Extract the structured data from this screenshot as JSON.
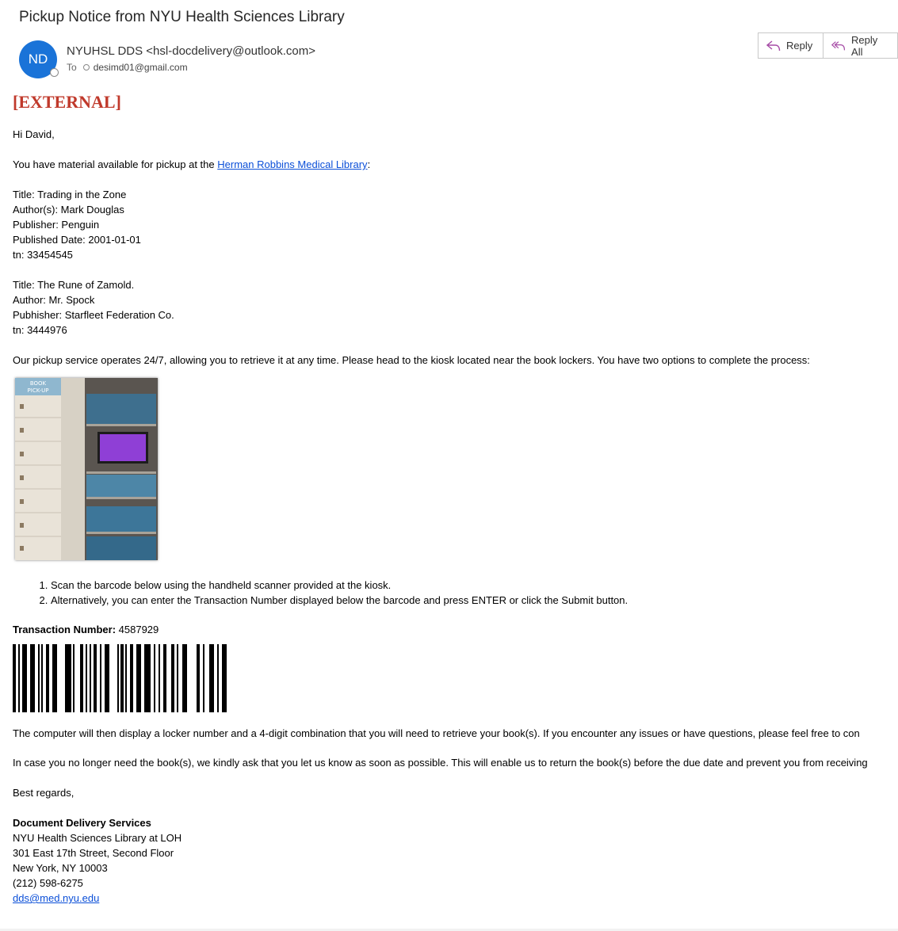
{
  "email": {
    "subject": "Pickup Notice from NYU Health Sciences Library",
    "avatar_initials": "ND",
    "sender": "NYUHSL DDS <hsl-docdelivery@outlook.com>",
    "to_label": "To",
    "recipient": "desimd01@gmail.com",
    "actions": {
      "reply": "Reply",
      "reply_all": "Reply All"
    }
  },
  "body": {
    "external_tag": "[EXTERNAL]",
    "greeting": "Hi David,",
    "intro_before": "You have material available for pickup at the ",
    "library_link": "Herman Robbins Medical Library",
    "intro_after": ":",
    "items": [
      {
        "lines": [
          "Title: Trading in the Zone",
          "Author(s): Mark Douglas",
          "Publisher: Penguin",
          "Published Date: 2001-01-01",
          "tn: 33454545"
        ]
      },
      {
        "lines": [
          "Title: The Rune of Zamold.",
          "Author: Mr. Spock",
          "Pubhisher: Starfleet Federation Co.",
          "tn: 3444976"
        ]
      }
    ],
    "service_text": "Our pickup service operates 24/7, allowing you to retrieve it at any time. Please head to the kiosk located near the book lockers. You have two options to complete the process:",
    "photo_sign": "BOOK PICK-UP",
    "steps": [
      "Scan the barcode below using the handheld scanner provided at the kiosk.",
      "Alternatively, you can enter the Transaction Number displayed below the barcode and press ENTER or click the Submit button."
    ],
    "transaction_label": "Transaction Number:",
    "transaction_number": "4587929",
    "locker_text": "The computer will then display a locker number and a 4-digit combination that you will need to retrieve your book(s). If you encounter any issues or have questions, please feel free to con",
    "return_text": "In case you no longer need the book(s), we kindly ask that you let us know as soon as possible. This will enable us to return the book(s) before the due date and prevent you from receiving",
    "closing": "Best regards,",
    "signature": {
      "department": "Document Delivery Services",
      "org": "NYU Health Sciences Library at LOH",
      "street": "301 East 17th Street, Second Floor",
      "city": "New York, NY 10003",
      "phone": "(212) 598-6275",
      "email": "dds@med.nyu.edu"
    }
  },
  "colors": {
    "accent": "#1a73d8",
    "external": "#c0392b",
    "link": "#0b4fd8"
  }
}
